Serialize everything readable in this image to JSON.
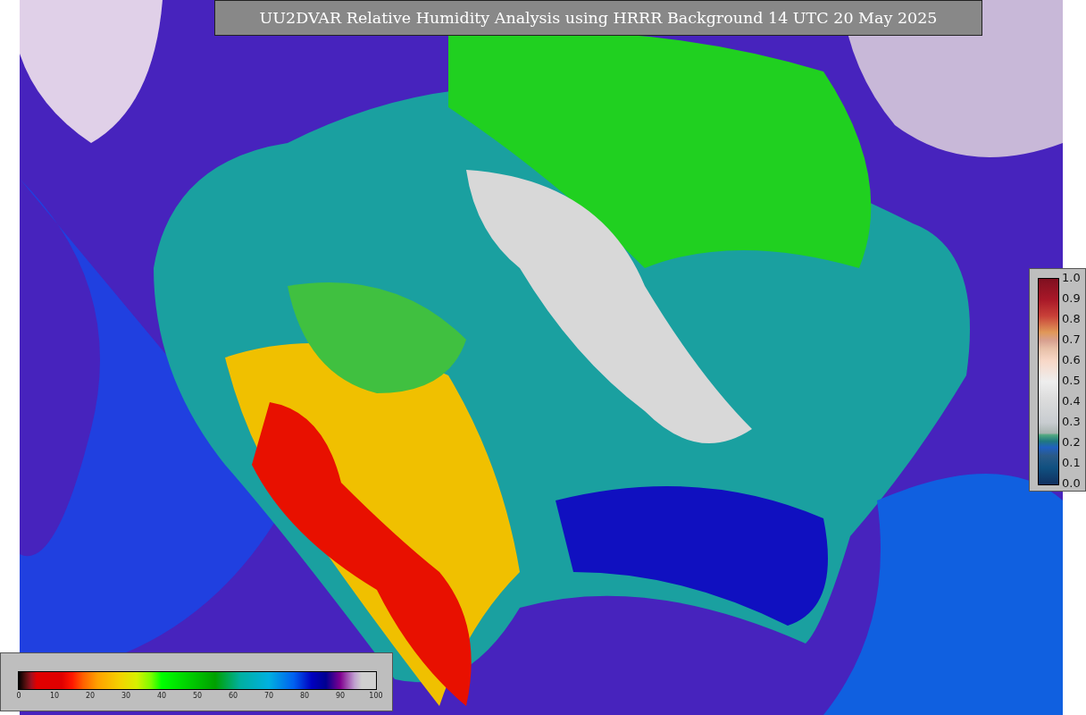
{
  "title": "UU2DVAR Relative Humidity Analysis using HRRR Background 14 UTC 20 May 2025",
  "humidity_scale": {
    "ticks": [
      "0",
      "10",
      "20",
      "30",
      "40",
      "50",
      "60",
      "70",
      "80",
      "90",
      "100"
    ]
  },
  "observation_scale": {
    "ticks": [
      "1.0",
      "0.9",
      "0.8",
      "0.7",
      "0.6",
      "0.5",
      "0.4",
      "0.3",
      "0.2",
      "0.1",
      "0.0"
    ]
  }
}
